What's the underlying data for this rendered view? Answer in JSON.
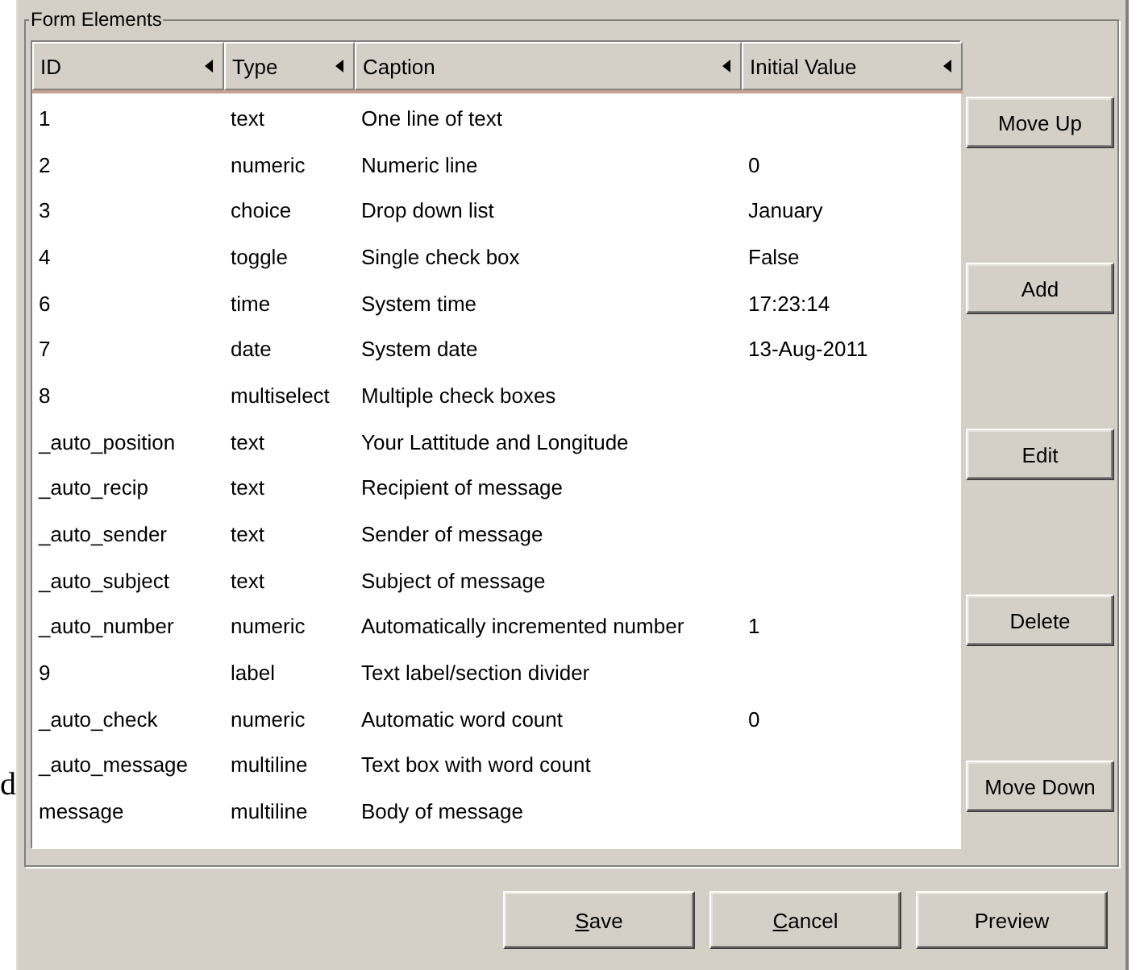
{
  "margin_text": "d",
  "group": {
    "title": "Form Elements"
  },
  "table": {
    "columns": [
      {
        "label": "ID"
      },
      {
        "label": "Type"
      },
      {
        "label": "Caption"
      },
      {
        "label": "Initial Value"
      }
    ],
    "rows": [
      {
        "id": "1",
        "type": "text",
        "caption": "One line of text",
        "initial_value": ""
      },
      {
        "id": "2",
        "type": "numeric",
        "caption": "Numeric line",
        "initial_value": "0"
      },
      {
        "id": "3",
        "type": "choice",
        "caption": "Drop down list",
        "initial_value": "January"
      },
      {
        "id": "4",
        "type": "toggle",
        "caption": "Single check box",
        "initial_value": "False"
      },
      {
        "id": "6",
        "type": "time",
        "caption": "System time",
        "initial_value": "17:23:14"
      },
      {
        "id": "7",
        "type": "date",
        "caption": "System date",
        "initial_value": "13-Aug-2011"
      },
      {
        "id": "8",
        "type": "multiselect",
        "caption": "Multiple check boxes",
        "initial_value": ""
      },
      {
        "id": "_auto_position",
        "type": "text",
        "caption": "Your Lattitude and Longitude",
        "initial_value": ""
      },
      {
        "id": "_auto_recip",
        "type": "text",
        "caption": "Recipient of message",
        "initial_value": ""
      },
      {
        "id": "_auto_sender",
        "type": "text",
        "caption": "Sender of message",
        "initial_value": ""
      },
      {
        "id": "_auto_subject",
        "type": "text",
        "caption": "Subject of message",
        "initial_value": ""
      },
      {
        "id": "_auto_number",
        "type": "numeric",
        "caption": "Automatically incremented number",
        "initial_value": "1"
      },
      {
        "id": "9",
        "type": "label",
        "caption": "Text label/section divider",
        "initial_value": ""
      },
      {
        "id": "_auto_check",
        "type": "numeric",
        "caption": "Automatic word count",
        "initial_value": "0"
      },
      {
        "id": "_auto_message",
        "type": "multiline",
        "caption": "Text box with word count",
        "initial_value": ""
      },
      {
        "id": "message",
        "type": "multiline",
        "caption": "Body of message",
        "initial_value": ""
      }
    ]
  },
  "side_buttons": [
    "Move Up",
    "Add",
    "Edit",
    "Delete",
    "Move Down"
  ],
  "bottom_buttons": [
    {
      "label": "Save",
      "mnemonic": true
    },
    {
      "label": "Cancel",
      "mnemonic": true
    },
    {
      "label": "Preview",
      "mnemonic": false
    }
  ]
}
